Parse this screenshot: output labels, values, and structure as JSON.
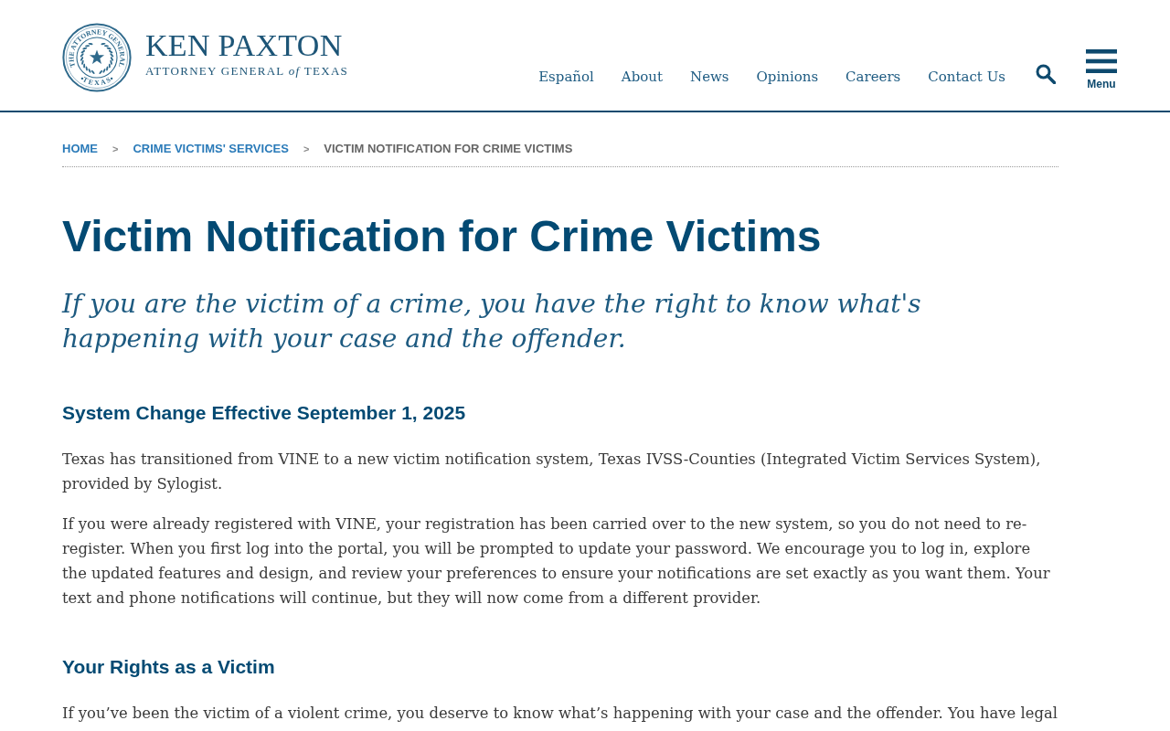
{
  "header": {
    "logo": {
      "seal_top": "THE ATTORNEY GENERAL",
      "seal_bottom": "TEXAS",
      "name": "KEN PAXTON",
      "tagline": "ATTORNEY GENERAL *of* TEXAS"
    },
    "nav": [
      "Español",
      "About",
      "News",
      "Opinions",
      "Careers",
      "Contact Us"
    ],
    "menu_button": {
      "label": "Menu"
    }
  },
  "breadcrumb": [
    {
      "kind": "link",
      "label": "HOME"
    },
    {
      "kind": "separator",
      "label": ">"
    },
    {
      "kind": "link",
      "label": "CRIME VICTIMS' SERVICES"
    },
    {
      "kind": "separator",
      "label": ">"
    },
    {
      "kind": "current",
      "label": "VICTIM NOTIFICATION FOR CRIME VICTIMS"
    }
  ],
  "title": "Victim Notification for Crime Victims",
  "lead": "If you are the victim of a crime, you have the right to know what's happening with your case and the offender.",
  "sections": [
    {
      "heading": "System Change Effective September 1, 2025",
      "paragraphs": [
        "Texas has transitioned from VINE to a new victim notification system, Texas IVSS-Counties (Integrated Victim Services System), provided by Sylogist.",
        "If you were already registered with VINE, your registration has been carried over to the new system, so you do not need to re-register. When you first log into the portal, you will be prompted to update your password. We encourage you to log in, explore the updated features and design, and review your preferences to ensure your notifications are set exactly as you want them. Your text and phone notifications will continue, but they will now come from a different provider."
      ]
    },
    {
      "heading": "Your Rights as a Victim",
      "paragraphs": [
        "If you’ve been the victim of a violent crime, you deserve to know what’s happening with your case and the offender. You have legal"
      ]
    }
  ]
}
